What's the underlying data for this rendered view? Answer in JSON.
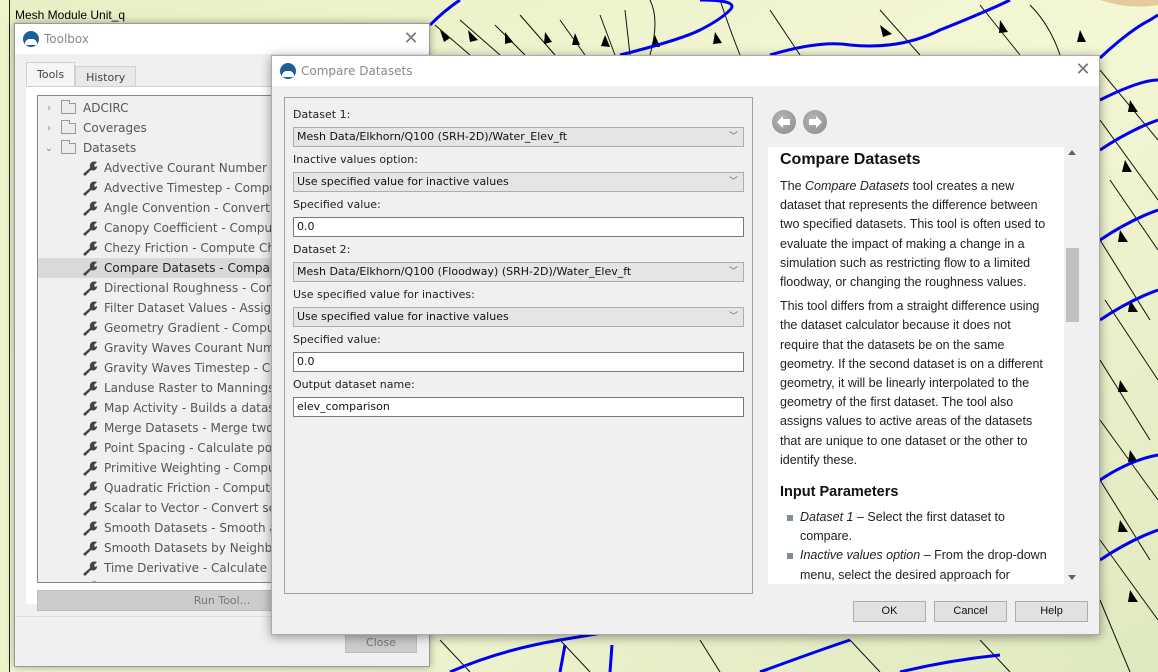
{
  "background": {
    "label": "Mesh Module Unit_q"
  },
  "toolbox": {
    "title": "Toolbox",
    "tabs": [
      {
        "label": "Tools",
        "active": true
      },
      {
        "label": "History",
        "active": false
      }
    ],
    "tree": [
      {
        "type": "folder",
        "label": "ADCIRC",
        "expanded": false
      },
      {
        "type": "folder",
        "label": "Coverages",
        "expanded": false
      },
      {
        "type": "folder",
        "label": "Datasets",
        "expanded": true
      },
      {
        "type": "tool",
        "label": "Advective Courant Number - Co"
      },
      {
        "type": "tool",
        "label": "Advective Timestep - Compute t"
      },
      {
        "type": "tool",
        "label": "Angle Convention - Convert bet"
      },
      {
        "type": "tool",
        "label": "Canopy Coefficient - Compute a"
      },
      {
        "type": "tool",
        "label": "Chezy Friction - Compute Chezy"
      },
      {
        "type": "tool",
        "label": "Compare Datasets - Compare tw",
        "selected": true
      },
      {
        "type": "tool",
        "label": "Directional Roughness - Convert"
      },
      {
        "type": "tool",
        "label": "Filter Dataset Values - Assign dat"
      },
      {
        "type": "tool",
        "label": "Geometry Gradient - Compute g"
      },
      {
        "type": "tool",
        "label": "Gravity Waves Courant Number"
      },
      {
        "type": "tool",
        "label": "Gravity Waves Timestep - Comp"
      },
      {
        "type": "tool",
        "label": "Landuse Raster to Mannings N -"
      },
      {
        "type": "tool",
        "label": "Map Activity - Builds a dataset w"
      },
      {
        "type": "tool",
        "label": "Merge Datasets - Merge two tran"
      },
      {
        "type": "tool",
        "label": "Point Spacing - Calculate point s"
      },
      {
        "type": "tool",
        "label": "Primitive Weighting - Compute"
      },
      {
        "type": "tool",
        "label": "Quadratic Friction - Compute qu"
      },
      {
        "type": "tool",
        "label": "Scalar to Vector - Convert scalar"
      },
      {
        "type": "tool",
        "label": "Smooth Datasets - Smooth a dat"
      },
      {
        "type": "tool",
        "label": "Smooth Datasets by Neighbor -"
      },
      {
        "type": "tool",
        "label": "Time Derivative - Calculate the ti"
      }
    ],
    "run_button": "Run Tool...",
    "close_button": "Close"
  },
  "dialog": {
    "title": "Compare Datasets",
    "form": {
      "dataset1_label": "Dataset 1:",
      "dataset1_value": "Mesh Data/Elkhorn/Q100 (SRH-2D)/Water_Elev_ft",
      "inactive1_label": "Inactive values option:",
      "inactive1_value": "Use specified value for inactive values",
      "specified1_label": "Specified value:",
      "specified1_value": "0.0",
      "dataset2_label": "Dataset 2:",
      "dataset2_value": "Mesh Data/Elkhorn/Q100 (Floodway) (SRH-2D)/Water_Elev_ft",
      "inactive2_label": "Use specified value for inactives:",
      "inactive2_value": "Use specified value for inactive values",
      "specified2_label": "Specified value:",
      "specified2_value": "0.0",
      "output_label": "Output dataset name:",
      "output_value": "elev_comparison"
    },
    "help": {
      "title": "Compare Datasets",
      "p1_pre": "The ",
      "p1_em": "Compare Datasets",
      "p1_post": " tool creates a new dataset that represents the difference between two specified datasets. This tool is often used to evaluate the impact of making a change in a simulation such as restricting flow to a limited floodway, or changing the roughness values.",
      "p2": "This tool differs from a straight difference using the dataset calculator because it does not require that the datasets be on the same geometry. If the second dataset is on a different geometry, it will be linearly interpolated to the geometry of the first dataset. The tool also assigns values to active areas of the datasets that are unique to one dataset or the other to identify these.",
      "section_title": "Input Parameters",
      "params": [
        {
          "name": "Dataset 1",
          "desc": " – Select the first dataset to compare."
        },
        {
          "name": "Inactive values option",
          "desc": " – From the drop-down menu, select the desired approach for"
        }
      ]
    },
    "buttons": {
      "ok": "OK",
      "cancel": "Cancel",
      "help": "Help"
    }
  }
}
